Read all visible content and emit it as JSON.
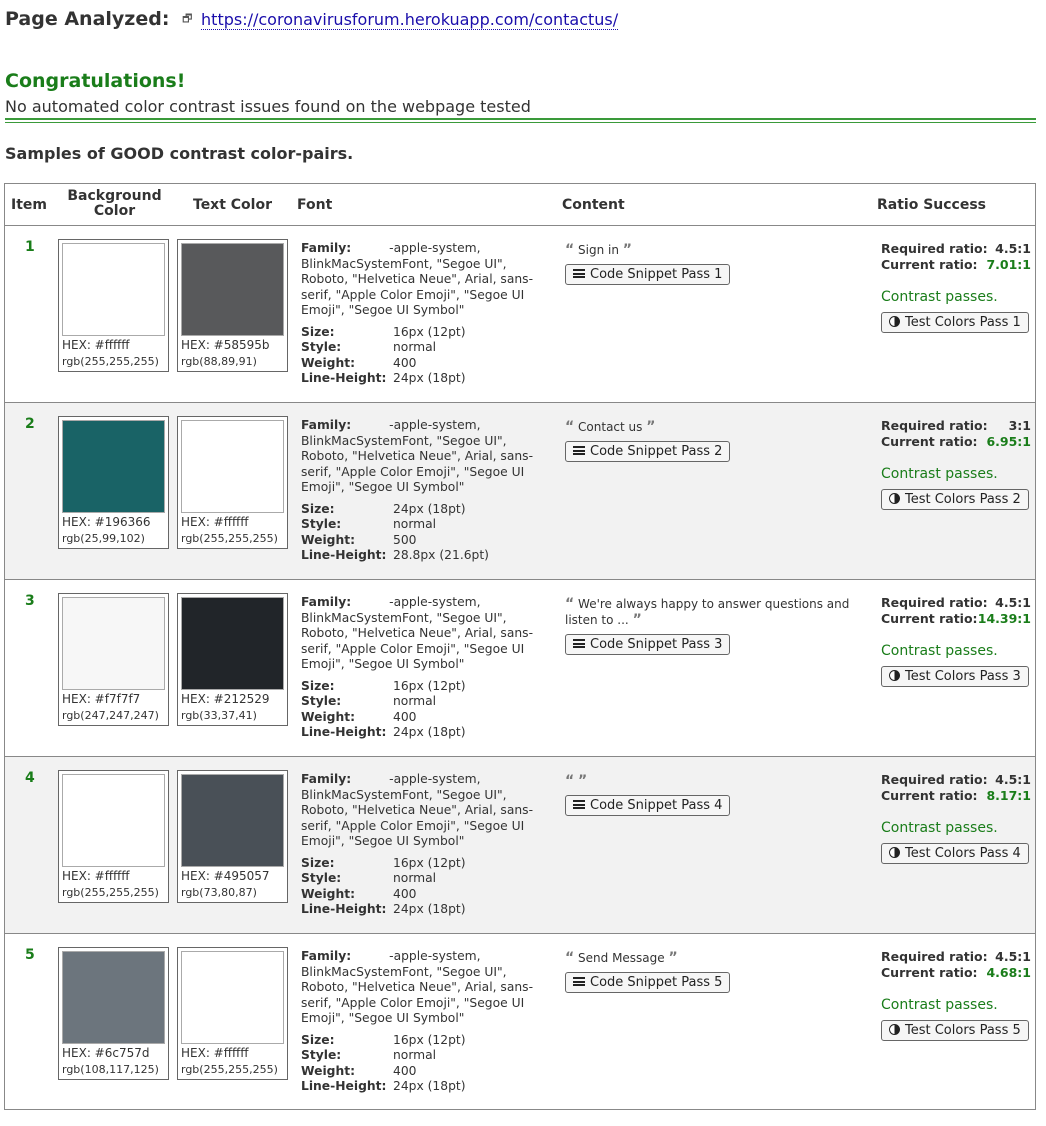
{
  "header": {
    "label": "Page Analyzed:",
    "ext_icon": "external-link-icon",
    "url": "https://coronavirusforum.herokuapp.com/contactus/"
  },
  "result": {
    "title": "Congratulations!",
    "message": "No automated color contrast issues found on the webpage tested"
  },
  "section_title": "Samples of GOOD contrast color-pairs.",
  "table": {
    "columns": {
      "item": "Item",
      "background_line1": "Background",
      "background_line2": "Color",
      "text_color": "Text Color",
      "font": "Font",
      "content": "Content",
      "ratio": "Ratio Success"
    },
    "labels": {
      "family": "Family:",
      "size": "Size:",
      "style": "Style:",
      "weight": "Weight:",
      "line_height": "Line-Height:",
      "required": "Required ratio:",
      "current": "Current ratio:",
      "passes": "Contrast passes."
    },
    "rows": [
      {
        "num": "1",
        "bg": {
          "hex_label": "HEX: #ffffff",
          "rgb": "rgb(255,255,255)",
          "color": "#ffffff"
        },
        "fg": {
          "hex_label": "HEX: #58595b",
          "rgb": "rgb(88,89,91)",
          "color": "#58595b"
        },
        "family": "-apple-system, BlinkMacSystemFont, \"Segoe UI\", Roboto, \"Helvetica Neue\", Arial, sans-serif, \"Apple Color Emoji\", \"Segoe UI Emoji\", \"Segoe UI Symbol\"",
        "size": "16px (12pt)",
        "style": "normal",
        "weight": "400",
        "line_height": "24px (18pt)",
        "content_text": "Sign in",
        "snippet": "Code Snippet Pass 1",
        "required": "4.5:1",
        "current": "7.01:1",
        "test": "Test Colors Pass 1"
      },
      {
        "num": "2",
        "bg": {
          "hex_label": "HEX: #196366",
          "rgb": "rgb(25,99,102)",
          "color": "#196366"
        },
        "fg": {
          "hex_label": "HEX: #ffffff",
          "rgb": "rgb(255,255,255)",
          "color": "#ffffff"
        },
        "family": "-apple-system, BlinkMacSystemFont, \"Segoe UI\", Roboto, \"Helvetica Neue\", Arial, sans-serif, \"Apple Color Emoji\", \"Segoe UI Emoji\", \"Segoe UI Symbol\"",
        "size": "24px (18pt)",
        "style": "normal",
        "weight": "500",
        "line_height": "28.8px (21.6pt)",
        "content_text": "Contact us",
        "snippet": "Code Snippet Pass 2",
        "required": "3:1",
        "current": "6.95:1",
        "test": "Test Colors Pass 2"
      },
      {
        "num": "3",
        "bg": {
          "hex_label": "HEX: #f7f7f7",
          "rgb": "rgb(247,247,247)",
          "color": "#f7f7f7"
        },
        "fg": {
          "hex_label": "HEX: #212529",
          "rgb": "rgb(33,37,41)",
          "color": "#212529"
        },
        "family": "-apple-system, BlinkMacSystemFont, \"Segoe UI\", Roboto, \"Helvetica Neue\", Arial, sans-serif, \"Apple Color Emoji\", \"Segoe UI Emoji\", \"Segoe UI Symbol\"",
        "size": "16px (12pt)",
        "style": "normal",
        "weight": "400",
        "line_height": "24px (18pt)",
        "content_text": "We're always happy to answer questions and listen to ...",
        "snippet": "Code Snippet Pass 3",
        "required": "4.5:1",
        "current": "14.39:1",
        "test": "Test Colors Pass 3"
      },
      {
        "num": "4",
        "bg": {
          "hex_label": "HEX: #ffffff",
          "rgb": "rgb(255,255,255)",
          "color": "#ffffff"
        },
        "fg": {
          "hex_label": "HEX: #495057",
          "rgb": "rgb(73,80,87)",
          "color": "#495057"
        },
        "family": "-apple-system, BlinkMacSystemFont, \"Segoe UI\", Roboto, \"Helvetica Neue\", Arial, sans-serif, \"Apple Color Emoji\", \"Segoe UI Emoji\", \"Segoe UI Symbol\"",
        "size": "16px (12pt)",
        "style": "normal",
        "weight": "400",
        "line_height": "24px (18pt)",
        "content_text": "",
        "snippet": "Code Snippet Pass 4",
        "required": "4.5:1",
        "current": "8.17:1",
        "test": "Test Colors Pass 4"
      },
      {
        "num": "5",
        "bg": {
          "hex_label": "HEX: #6c757d",
          "rgb": "rgb(108,117,125)",
          "color": "#6c757d"
        },
        "fg": {
          "hex_label": "HEX: #ffffff",
          "rgb": "rgb(255,255,255)",
          "color": "#ffffff"
        },
        "family": "-apple-system, BlinkMacSystemFont, \"Segoe UI\", Roboto, \"Helvetica Neue\", Arial, sans-serif, \"Apple Color Emoji\", \"Segoe UI Emoji\", \"Segoe UI Symbol\"",
        "size": "16px (12pt)",
        "style": "normal",
        "weight": "400",
        "line_height": "24px (18pt)",
        "content_text": "Send Message",
        "snippet": "Code Snippet Pass 5",
        "required": "4.5:1",
        "current": "4.68:1",
        "test": "Test Colors Pass 5"
      }
    ]
  },
  "icons": {
    "open_quote": "“",
    "close_quote": "”",
    "snippet_icon": "lines-icon",
    "test_icon": "contrast-icon"
  },
  "colors": {
    "green": "#1a7d1a",
    "link": "#1a0dab"
  }
}
